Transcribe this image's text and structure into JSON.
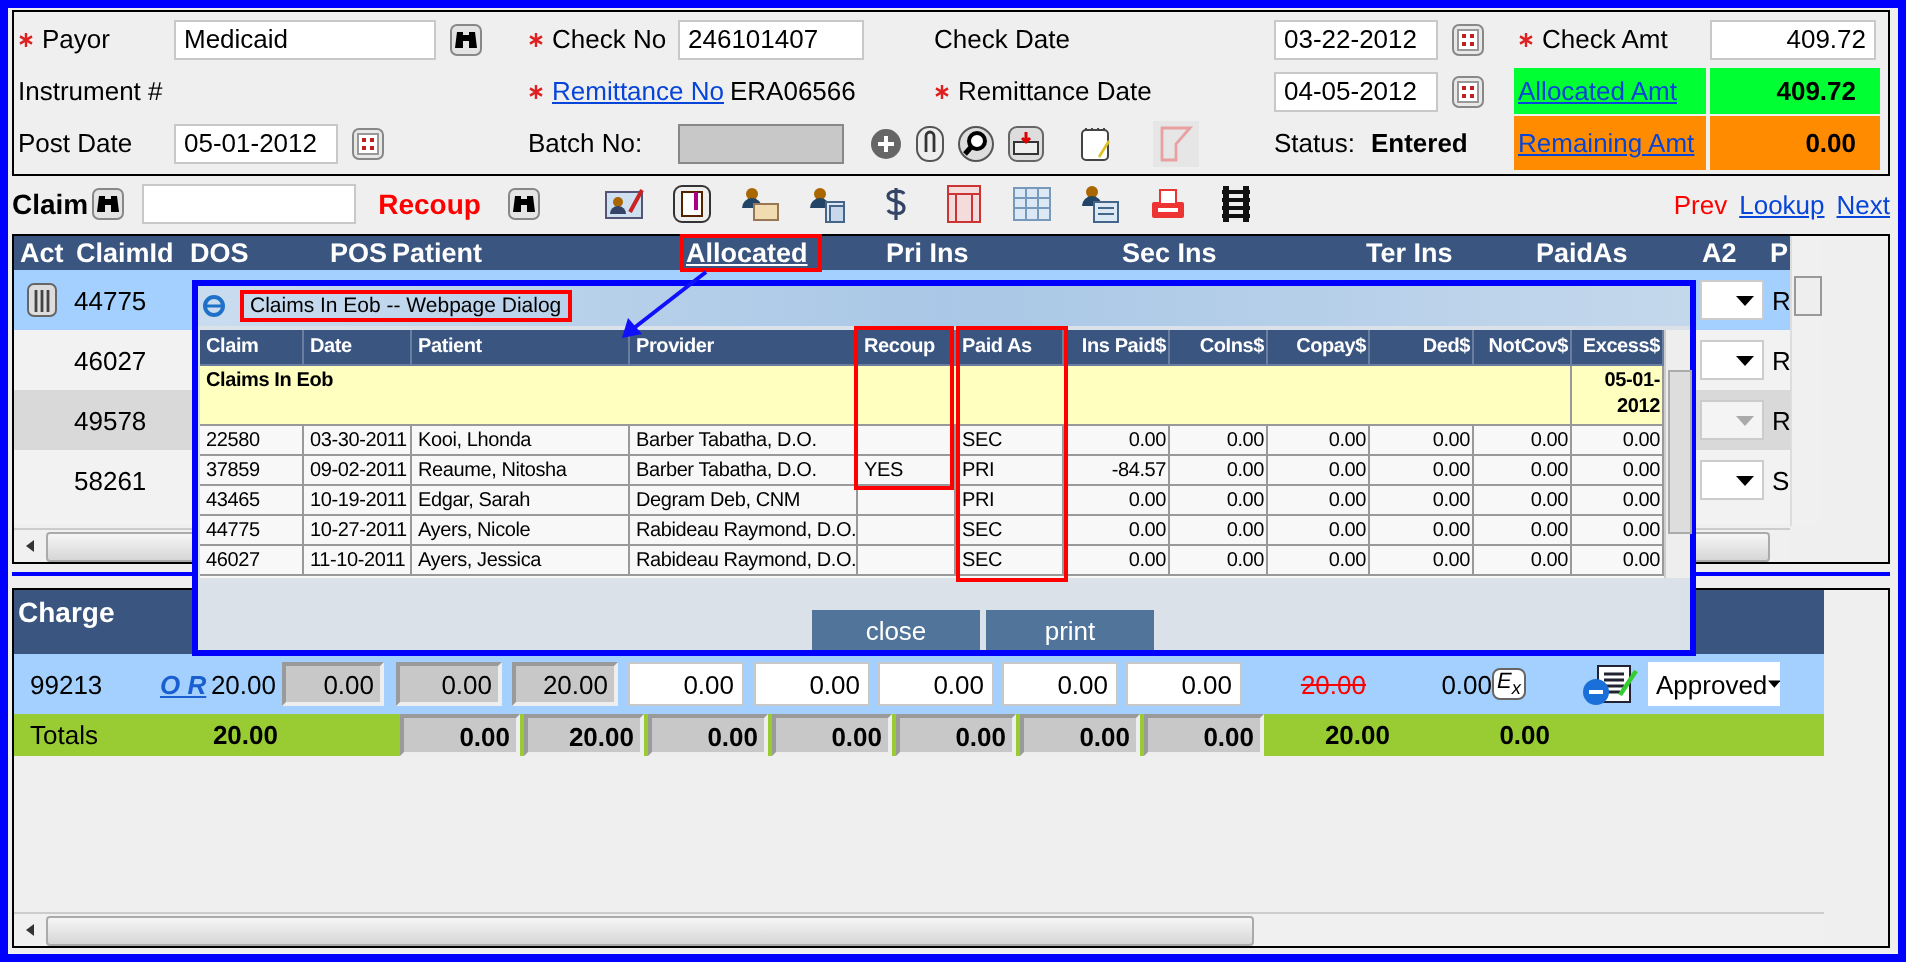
{
  "form": {
    "payor": {
      "label": "Payor",
      "required": true,
      "value": "Medicaid"
    },
    "check_no": {
      "label": "Check No",
      "required": true,
      "value": "246101407"
    },
    "check_date": {
      "label": "Check Date",
      "required": false,
      "value": "03-22-2012"
    },
    "check_amt": {
      "label": "Check Amt",
      "required": true,
      "value": "409.72"
    },
    "instrument": {
      "label": "Instrument #",
      "required": false
    },
    "remittance_no": {
      "label": "Remittance No",
      "required": true,
      "value": "ERA06566"
    },
    "remittance_date": {
      "label": "Remittance Date",
      "required": true,
      "value": "04-05-2012"
    },
    "allocated_amt": {
      "label": "Allocated Amt",
      "value": "409.72"
    },
    "post_date": {
      "label": "Post Date",
      "required": false,
      "value": "05-01-2012"
    },
    "batch_no": {
      "label": "Batch No:",
      "required": false,
      "disabled": true
    },
    "status": {
      "label": "Status:",
      "value": "Entered"
    },
    "remaining_amt": {
      "label": "Remaining Amt",
      "value": "0.00"
    }
  },
  "toolbar": {
    "claim_label": "Claim",
    "recoup_label": "Recoup",
    "nav": [
      {
        "label": "Prev",
        "disabled": true
      },
      {
        "label": "Lookup",
        "disabled": false
      },
      {
        "label": "Next",
        "disabled": false
      }
    ]
  },
  "claims_grid": {
    "columns": [
      {
        "label": "Act",
        "underlined": false
      },
      {
        "label": "ClaimId",
        "underlined": false
      },
      {
        "label": "DOS",
        "underlined": false
      },
      {
        "label": "POS",
        "underlined": false
      },
      {
        "label": "Patient",
        "underlined": false
      },
      {
        "label": "Allocated",
        "underlined": true
      },
      {
        "label": "Pri Ins",
        "underlined": false
      },
      {
        "label": "Sec Ins",
        "underlined": false
      },
      {
        "label": "Ter Ins",
        "underlined": false
      },
      {
        "label": "PaidAs",
        "underlined": false
      },
      {
        "label": "A2",
        "underlined": false
      },
      {
        "label": "P",
        "underlined": false
      }
    ],
    "rows": [
      {
        "claim_id": "44775",
        "selected": true,
        "deletable": true,
        "a2_disabled": false,
        "p": "R"
      },
      {
        "claim_id": "46027",
        "selected": false,
        "deletable": false,
        "a2_disabled": false,
        "p": "R"
      },
      {
        "claim_id": "49578",
        "selected": false,
        "deletable": false,
        "a2_disabled": true,
        "p": "R"
      },
      {
        "claim_id": "58261",
        "selected": false,
        "deletable": false,
        "a2_disabled": false,
        "p": "S"
      }
    ]
  },
  "dialog": {
    "title": "Claims In Eob -- Webpage Dialog",
    "columns": [
      "Claim",
      "Date",
      "Patient",
      "Provider",
      "Recoup",
      "Paid As",
      "Ins Paid$",
      "CoIns$",
      "Copay$",
      "Ded$",
      "NotCov$",
      "Excess$"
    ],
    "group": {
      "label": "Claims In Eob",
      "date": "05-01-2012"
    },
    "rows": [
      [
        "22580",
        "03-30-2011",
        "Kooi, Lhonda",
        "Barber Tabatha, D.O.",
        "",
        "SEC",
        "0.00",
        "0.00",
        "0.00",
        "0.00",
        "0.00",
        "0.00"
      ],
      [
        "37859",
        "09-02-2011",
        "Reaume, Nitosha",
        "Barber Tabatha, D.O.",
        "YES",
        "PRI",
        "-84.57",
        "0.00",
        "0.00",
        "0.00",
        "0.00",
        "0.00"
      ],
      [
        "43465",
        "10-19-2011",
        "Edgar, Sarah",
        "Degram Deb, CNM",
        "",
        "PRI",
        "0.00",
        "0.00",
        "0.00",
        "0.00",
        "0.00",
        "0.00"
      ],
      [
        "44775",
        "10-27-2011",
        "Ayers, Nicole",
        "Rabideau Raymond, D.O.",
        "",
        "SEC",
        "0.00",
        "0.00",
        "0.00",
        "0.00",
        "0.00",
        "0.00"
      ],
      [
        "46027",
        "11-10-2011",
        "Ayers, Jessica",
        "Rabideau Raymond, D.O.",
        "",
        "SEC",
        "0.00",
        "0.00",
        "0.00",
        "0.00",
        "0.00",
        "0.00"
      ]
    ],
    "buttons": [
      "close",
      "print"
    ]
  },
  "charges": {
    "header": "Charge",
    "row": {
      "charge": "99213",
      "link": "O R",
      "amount": "20.00",
      "readonly": [
        "0.00",
        "0.00",
        "20.00"
      ],
      "inputs": [
        "0.00",
        "0.00",
        "0.00",
        "0.00",
        "0.00"
      ],
      "allowed": {
        "value": "20.00",
        "struck": true
      },
      "balance": "0.00",
      "ex_button": "E$_{x}$",
      "status": "Approved"
    },
    "totals": {
      "label": "Totals",
      "amount": "20.00",
      "boxes": [
        "0.00",
        "20.00",
        "0.00",
        "0.00",
        "0.00",
        "0.00",
        "0.00"
      ],
      "allowed": "20.00",
      "balance": "0.00"
    }
  }
}
